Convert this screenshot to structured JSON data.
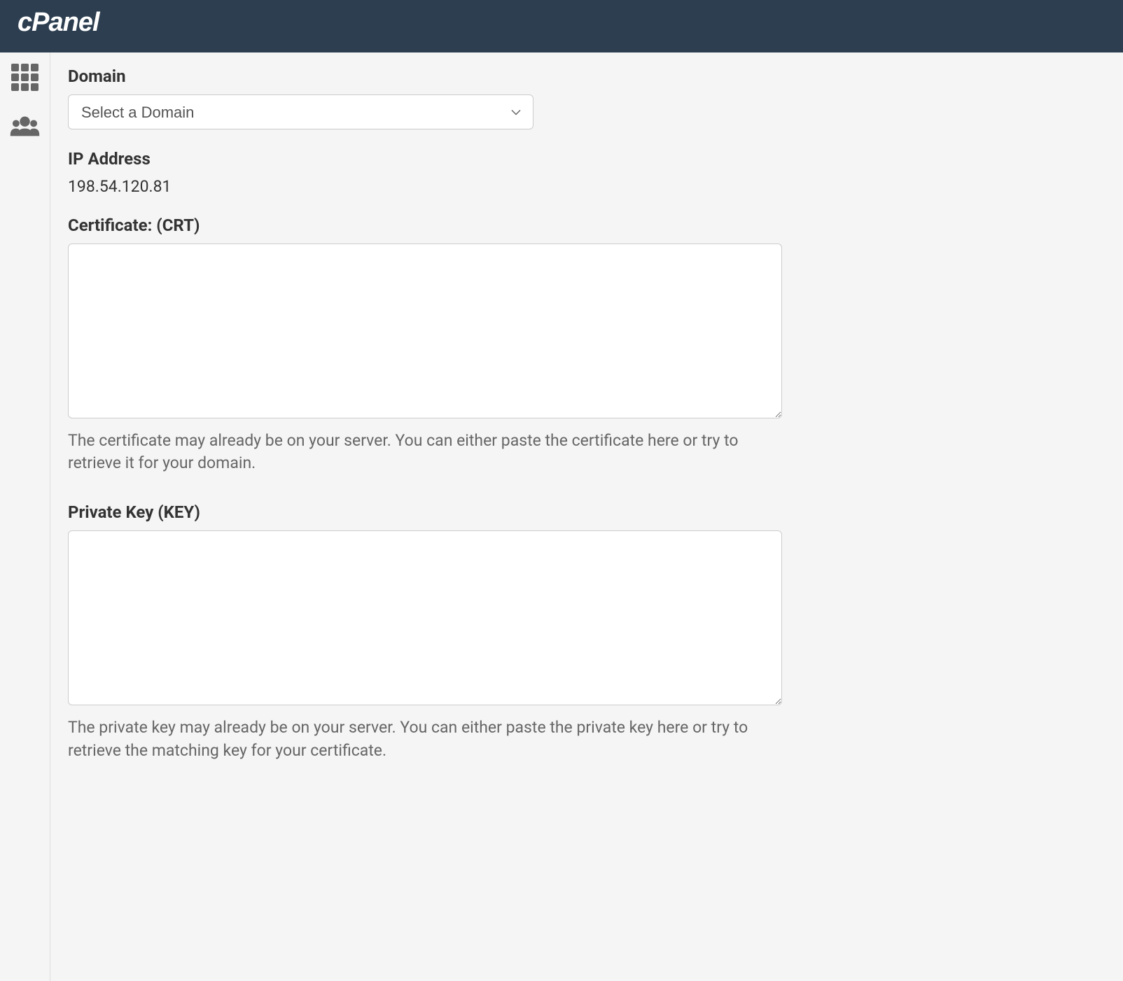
{
  "header": {
    "logo_text": "cPanel"
  },
  "sidebar": {
    "items": [
      {
        "name": "grid-apps-icon"
      },
      {
        "name": "users-icon"
      }
    ]
  },
  "form": {
    "domain": {
      "label": "Domain",
      "selected": "Select a Domain"
    },
    "ip_address": {
      "label": "IP Address",
      "value": "198.54.120.81"
    },
    "certificate": {
      "label": "Certificate: (CRT)",
      "value": "",
      "help": "The certificate may already be on your server. You can either paste the certificate here or try to retrieve it for your domain."
    },
    "private_key": {
      "label": "Private Key (KEY)",
      "value": "",
      "help": "The private key may already be on your server. You can either paste the private key here or try to retrieve the matching key for your certificate."
    }
  }
}
